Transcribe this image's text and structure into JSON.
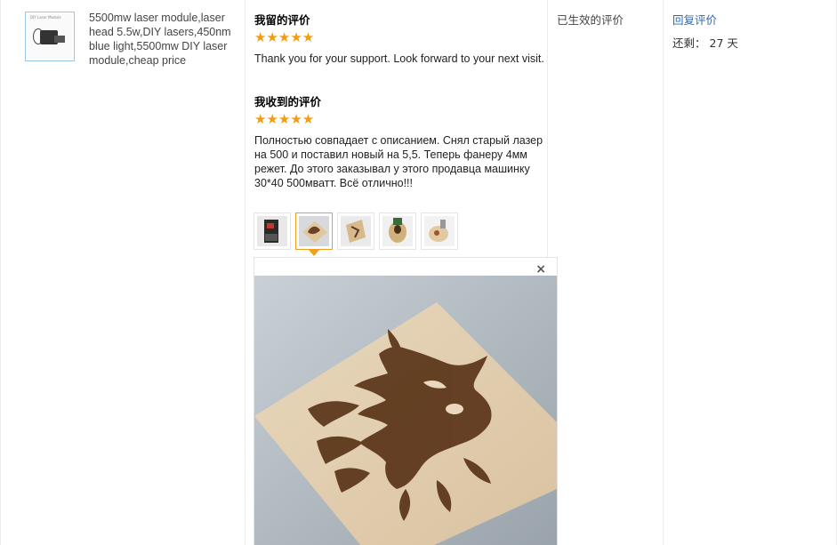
{
  "product": {
    "title": "5500mw laser module,laser head 5.5w,DIY lasers,450nm blue light,5500mw DIY laser module,cheap price",
    "thumb_caption": "DIY Laser Module",
    "thumb_icon": "laser-module-photo"
  },
  "my_feedback": {
    "heading": "我留的评价",
    "stars": "★★★★★",
    "rating": 5,
    "text": "Thank you for your support. Look forward to your next visit."
  },
  "received_feedback": {
    "heading": "我收到的评价",
    "stars": "★★★★★",
    "rating": 5,
    "text": "Полностью совпадает с описанием. Снял старый лазер на 500 и поставил новый на 5,5. Теперь фанеру 4мм режет. До этого заказывал у этого продавца машинку 30*40 500мватт. Всё отлично!!!",
    "photos": [
      {
        "name": "photo-1",
        "active": false
      },
      {
        "name": "photo-2",
        "active": true
      },
      {
        "name": "photo-3",
        "active": false
      },
      {
        "name": "photo-4",
        "active": false
      },
      {
        "name": "photo-5",
        "active": false
      }
    ]
  },
  "viewer": {
    "close_label": "×"
  },
  "status": {
    "label": "已生效的评价"
  },
  "actions": {
    "reply_label": "回复评价",
    "remaining_label": "还剩：",
    "remaining_value": "27 天"
  },
  "colors": {
    "star": "#f39c12",
    "link": "#2a6bb5",
    "active_border": "#f0a020"
  }
}
